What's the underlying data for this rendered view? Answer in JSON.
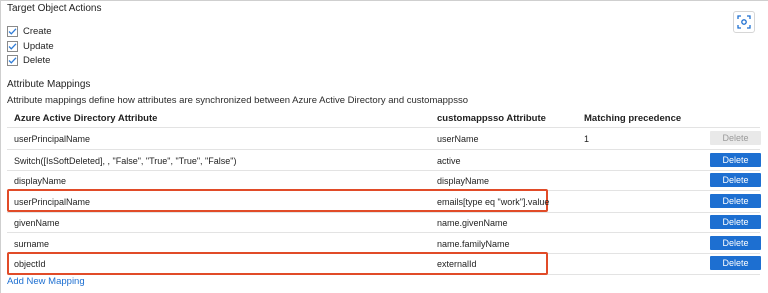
{
  "target_actions": {
    "title": "Target Object Actions",
    "options": [
      {
        "label": "Create",
        "checked": true
      },
      {
        "label": "Update",
        "checked": true
      },
      {
        "label": "Delete",
        "checked": true
      }
    ]
  },
  "mappings": {
    "title": "Attribute Mappings",
    "description": "Attribute mappings define how attributes are synchronized between Azure Active Directory and customappsso",
    "columns": {
      "aad": "Azure Active Directory Attribute",
      "app": "customappsso Attribute",
      "precedence": "Matching precedence"
    },
    "rows": [
      {
        "aad": "userPrincipalName",
        "app": "userName",
        "precedence": "1",
        "delete": "Delete",
        "delete_enabled": false,
        "highlighted": false
      },
      {
        "aad": "Switch([IsSoftDeleted], , \"False\", \"True\", \"True\", \"False\")",
        "app": "active",
        "precedence": "",
        "delete": "Delete",
        "delete_enabled": true,
        "highlighted": false
      },
      {
        "aad": "displayName",
        "app": "displayName",
        "precedence": "",
        "delete": "Delete",
        "delete_enabled": true,
        "highlighted": false
      },
      {
        "aad": "userPrincipalName",
        "app": "emails[type eq \"work\"].value",
        "precedence": "",
        "delete": "Delete",
        "delete_enabled": true,
        "highlighted": true
      },
      {
        "aad": "givenName",
        "app": "name.givenName",
        "precedence": "",
        "delete": "Delete",
        "delete_enabled": true,
        "highlighted": false
      },
      {
        "aad": "surname",
        "app": "name.familyName",
        "precedence": "",
        "delete": "Delete",
        "delete_enabled": true,
        "highlighted": false
      },
      {
        "aad": "objectId",
        "app": "externalId",
        "precedence": "",
        "delete": "Delete",
        "delete_enabled": true,
        "highlighted": true
      }
    ],
    "add_link": "Add New Mapping"
  },
  "icons": {
    "scan": "scan-icon",
    "check": "check-icon"
  },
  "colors": {
    "accent": "#1d6fd1",
    "highlight": "#e14b28",
    "disabled_button": "#e9e9e9"
  }
}
